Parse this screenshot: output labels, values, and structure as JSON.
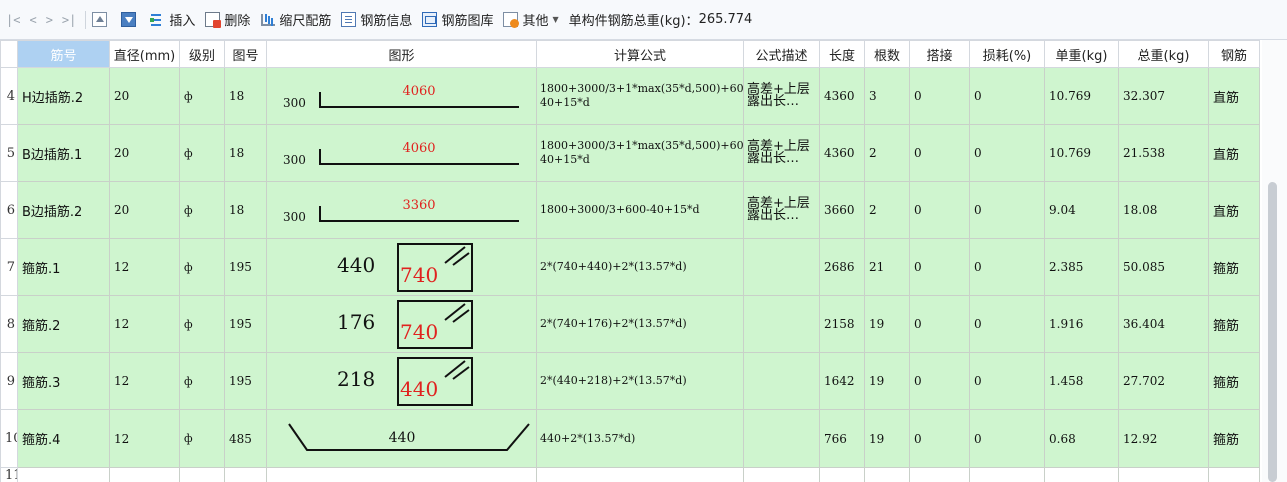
{
  "toolbar": {
    "nav": [
      "|<",
      "<",
      ">",
      ">|"
    ],
    "insert": "插入",
    "delete": "删除",
    "scale": "缩尺配筋",
    "info": "钢筋信息",
    "library": "钢筋图库",
    "other": "其他",
    "total_label": "单构件钢筋总重(kg)：",
    "total_value": "265.774"
  },
  "columns": [
    "筋号",
    "直径(mm)",
    "级别",
    "图号",
    "图形",
    "计算公式",
    "公式描述",
    "长度",
    "根数",
    "搭接",
    "损耗(%)",
    "单重(kg)",
    "总重(kg)",
    "钢筋"
  ],
  "colors": {
    "row_bg": "#cff5cf",
    "header_hl": "#aed1f2",
    "figure_red": "#e0221f"
  },
  "rows": [
    {
      "idx": "4",
      "name": "H边插筋.2",
      "dia": "20",
      "grade": "ф",
      "fig_no": "18",
      "fig": {
        "lead": "300",
        "len": "4060"
      },
      "formula": "1800+3000/3+1*max(35*d,500)+600-40+15*d",
      "desc": "高差+上层露出长…",
      "length": "4360",
      "count": "3",
      "lap": "0",
      "loss": "0",
      "unit_wt": "10.769",
      "total_wt": "32.307",
      "type": "直筋"
    },
    {
      "idx": "5",
      "name": "B边插筋.1",
      "dia": "20",
      "grade": "ф",
      "fig_no": "18",
      "fig": {
        "lead": "300",
        "len": "4060"
      },
      "formula": "1800+3000/3+1*max(35*d,500)+600-40+15*d",
      "desc": "高差+上层露出长…",
      "length": "4360",
      "count": "2",
      "lap": "0",
      "loss": "0",
      "unit_wt": "10.769",
      "total_wt": "21.538",
      "type": "直筋"
    },
    {
      "idx": "6",
      "name": "B边插筋.2",
      "dia": "20",
      "grade": "ф",
      "fig_no": "18",
      "fig": {
        "lead": "300",
        "len": "3360"
      },
      "formula": "1800+3000/3+600-40+15*d",
      "desc": "高差+上层露出长…",
      "length": "3660",
      "count": "2",
      "lap": "0",
      "loss": "0",
      "unit_wt": "9.04",
      "total_wt": "18.08",
      "type": "直筋"
    },
    {
      "idx": "7",
      "name": "箍筋.1",
      "dia": "12",
      "grade": "ф",
      "fig_no": "195",
      "fig": {
        "left": "440",
        "box": "740"
      },
      "formula": "2*(740+440)+2*(13.57*d)",
      "desc": "",
      "length": "2686",
      "count": "21",
      "lap": "0",
      "loss": "0",
      "unit_wt": "2.385",
      "total_wt": "50.085",
      "type": "箍筋"
    },
    {
      "idx": "8",
      "name": "箍筋.2",
      "dia": "12",
      "grade": "ф",
      "fig_no": "195",
      "fig": {
        "left": "176",
        "box": "740"
      },
      "formula": "2*(740+176)+2*(13.57*d)",
      "desc": "",
      "length": "2158",
      "count": "19",
      "lap": "0",
      "loss": "0",
      "unit_wt": "1.916",
      "total_wt": "36.404",
      "type": "箍筋"
    },
    {
      "idx": "9",
      "name": "箍筋.3",
      "dia": "12",
      "grade": "ф",
      "fig_no": "195",
      "fig": {
        "left": "218",
        "box": "440"
      },
      "formula": "2*(440+218)+2*(13.57*d)",
      "desc": "",
      "length": "1642",
      "count": "19",
      "lap": "0",
      "loss": "0",
      "unit_wt": "1.458",
      "total_wt": "27.702",
      "type": "箍筋"
    },
    {
      "idx": "10",
      "name": "箍筋.4",
      "dia": "12",
      "grade": "ф",
      "fig_no": "485",
      "fig": {
        "mid": "440"
      },
      "formula": "440+2*(13.57*d)",
      "desc": "",
      "length": "766",
      "count": "19",
      "lap": "0",
      "loss": "0",
      "unit_wt": "0.68",
      "total_wt": "12.92",
      "type": "箍筋"
    }
  ],
  "next_row_idx": "11"
}
